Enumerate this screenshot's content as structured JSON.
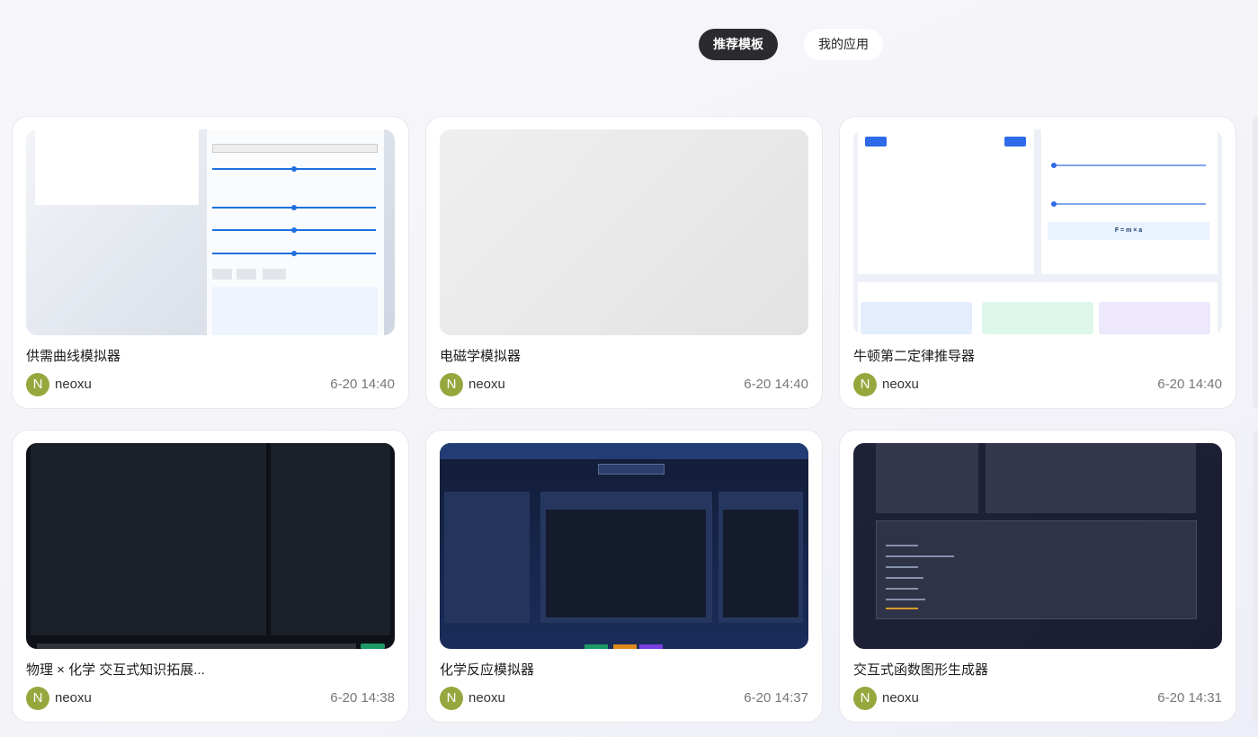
{
  "tabs": [
    {
      "label": "推荐模板",
      "active": true
    },
    {
      "label": "我的应用",
      "active": false
    }
  ],
  "cards": [
    {
      "title": "供需曲线模拟器",
      "author": "neoxu",
      "avatar_letter": "N",
      "time": "6-20 14:40"
    },
    {
      "title": "电磁学模拟器",
      "author": "neoxu",
      "avatar_letter": "N",
      "time": "6-20 14:40"
    },
    {
      "title": "牛顿第二定律推导器",
      "author": "neoxu",
      "avatar_letter": "N",
      "time": "6-20 14:40",
      "thumb_formula": "F = m × a"
    },
    {
      "title": "物理 × 化学 交互式知识拓展...",
      "author": "neoxu",
      "avatar_letter": "N",
      "time": "6-20 14:38"
    },
    {
      "title": "化学反应模拟器",
      "author": "neoxu",
      "avatar_letter": "N",
      "time": "6-20 14:37"
    },
    {
      "title": "交互式函数图形生成器",
      "author": "neoxu",
      "avatar_letter": "N",
      "time": "6-20 14:31"
    }
  ],
  "colors": {
    "active_tab_bg": "#2b2b2f",
    "avatar_bg": "#97a73e"
  }
}
